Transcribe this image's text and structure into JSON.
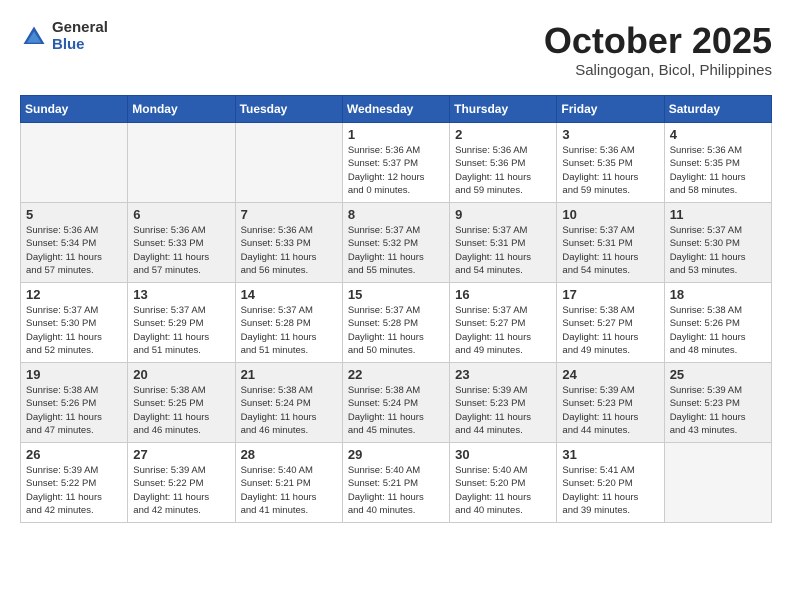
{
  "header": {
    "logo_general": "General",
    "logo_blue": "Blue",
    "month": "October 2025",
    "location": "Salingogan, Bicol, Philippines"
  },
  "days_of_week": [
    "Sunday",
    "Monday",
    "Tuesday",
    "Wednesday",
    "Thursday",
    "Friday",
    "Saturday"
  ],
  "weeks": [
    [
      {
        "day": "",
        "info": ""
      },
      {
        "day": "",
        "info": ""
      },
      {
        "day": "",
        "info": ""
      },
      {
        "day": "1",
        "info": "Sunrise: 5:36 AM\nSunset: 5:37 PM\nDaylight: 12 hours\nand 0 minutes."
      },
      {
        "day": "2",
        "info": "Sunrise: 5:36 AM\nSunset: 5:36 PM\nDaylight: 11 hours\nand 59 minutes."
      },
      {
        "day": "3",
        "info": "Sunrise: 5:36 AM\nSunset: 5:35 PM\nDaylight: 11 hours\nand 59 minutes."
      },
      {
        "day": "4",
        "info": "Sunrise: 5:36 AM\nSunset: 5:35 PM\nDaylight: 11 hours\nand 58 minutes."
      }
    ],
    [
      {
        "day": "5",
        "info": "Sunrise: 5:36 AM\nSunset: 5:34 PM\nDaylight: 11 hours\nand 57 minutes."
      },
      {
        "day": "6",
        "info": "Sunrise: 5:36 AM\nSunset: 5:33 PM\nDaylight: 11 hours\nand 57 minutes."
      },
      {
        "day": "7",
        "info": "Sunrise: 5:36 AM\nSunset: 5:33 PM\nDaylight: 11 hours\nand 56 minutes."
      },
      {
        "day": "8",
        "info": "Sunrise: 5:37 AM\nSunset: 5:32 PM\nDaylight: 11 hours\nand 55 minutes."
      },
      {
        "day": "9",
        "info": "Sunrise: 5:37 AM\nSunset: 5:31 PM\nDaylight: 11 hours\nand 54 minutes."
      },
      {
        "day": "10",
        "info": "Sunrise: 5:37 AM\nSunset: 5:31 PM\nDaylight: 11 hours\nand 54 minutes."
      },
      {
        "day": "11",
        "info": "Sunrise: 5:37 AM\nSunset: 5:30 PM\nDaylight: 11 hours\nand 53 minutes."
      }
    ],
    [
      {
        "day": "12",
        "info": "Sunrise: 5:37 AM\nSunset: 5:30 PM\nDaylight: 11 hours\nand 52 minutes."
      },
      {
        "day": "13",
        "info": "Sunrise: 5:37 AM\nSunset: 5:29 PM\nDaylight: 11 hours\nand 51 minutes."
      },
      {
        "day": "14",
        "info": "Sunrise: 5:37 AM\nSunset: 5:28 PM\nDaylight: 11 hours\nand 51 minutes."
      },
      {
        "day": "15",
        "info": "Sunrise: 5:37 AM\nSunset: 5:28 PM\nDaylight: 11 hours\nand 50 minutes."
      },
      {
        "day": "16",
        "info": "Sunrise: 5:37 AM\nSunset: 5:27 PM\nDaylight: 11 hours\nand 49 minutes."
      },
      {
        "day": "17",
        "info": "Sunrise: 5:38 AM\nSunset: 5:27 PM\nDaylight: 11 hours\nand 49 minutes."
      },
      {
        "day": "18",
        "info": "Sunrise: 5:38 AM\nSunset: 5:26 PM\nDaylight: 11 hours\nand 48 minutes."
      }
    ],
    [
      {
        "day": "19",
        "info": "Sunrise: 5:38 AM\nSunset: 5:26 PM\nDaylight: 11 hours\nand 47 minutes."
      },
      {
        "day": "20",
        "info": "Sunrise: 5:38 AM\nSunset: 5:25 PM\nDaylight: 11 hours\nand 46 minutes."
      },
      {
        "day": "21",
        "info": "Sunrise: 5:38 AM\nSunset: 5:24 PM\nDaylight: 11 hours\nand 46 minutes."
      },
      {
        "day": "22",
        "info": "Sunrise: 5:38 AM\nSunset: 5:24 PM\nDaylight: 11 hours\nand 45 minutes."
      },
      {
        "day": "23",
        "info": "Sunrise: 5:39 AM\nSunset: 5:23 PM\nDaylight: 11 hours\nand 44 minutes."
      },
      {
        "day": "24",
        "info": "Sunrise: 5:39 AM\nSunset: 5:23 PM\nDaylight: 11 hours\nand 44 minutes."
      },
      {
        "day": "25",
        "info": "Sunrise: 5:39 AM\nSunset: 5:23 PM\nDaylight: 11 hours\nand 43 minutes."
      }
    ],
    [
      {
        "day": "26",
        "info": "Sunrise: 5:39 AM\nSunset: 5:22 PM\nDaylight: 11 hours\nand 42 minutes."
      },
      {
        "day": "27",
        "info": "Sunrise: 5:39 AM\nSunset: 5:22 PM\nDaylight: 11 hours\nand 42 minutes."
      },
      {
        "day": "28",
        "info": "Sunrise: 5:40 AM\nSunset: 5:21 PM\nDaylight: 11 hours\nand 41 minutes."
      },
      {
        "day": "29",
        "info": "Sunrise: 5:40 AM\nSunset: 5:21 PM\nDaylight: 11 hours\nand 40 minutes."
      },
      {
        "day": "30",
        "info": "Sunrise: 5:40 AM\nSunset: 5:20 PM\nDaylight: 11 hours\nand 40 minutes."
      },
      {
        "day": "31",
        "info": "Sunrise: 5:41 AM\nSunset: 5:20 PM\nDaylight: 11 hours\nand 39 minutes."
      },
      {
        "day": "",
        "info": ""
      }
    ]
  ]
}
